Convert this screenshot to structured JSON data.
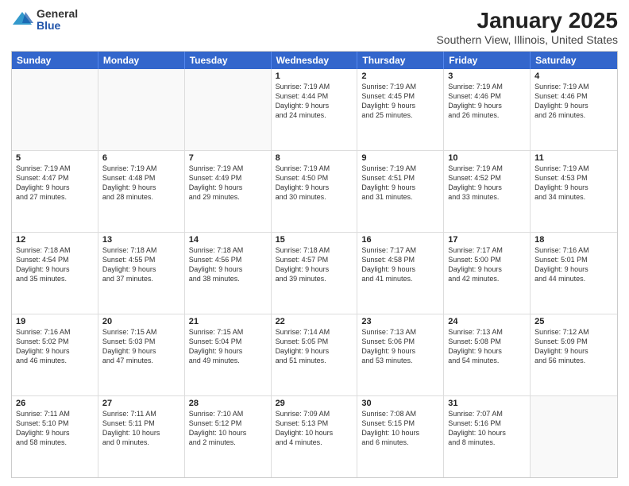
{
  "logo": {
    "general": "General",
    "blue": "Blue"
  },
  "header": {
    "title": "January 2025",
    "subtitle": "Southern View, Illinois, United States"
  },
  "days_of_week": [
    "Sunday",
    "Monday",
    "Tuesday",
    "Wednesday",
    "Thursday",
    "Friday",
    "Saturday"
  ],
  "weeks": [
    [
      {
        "day": "",
        "info": "",
        "empty": true
      },
      {
        "day": "",
        "info": "",
        "empty": true
      },
      {
        "day": "",
        "info": "",
        "empty": true
      },
      {
        "day": "1",
        "info": "Sunrise: 7:19 AM\nSunset: 4:44 PM\nDaylight: 9 hours\nand 24 minutes."
      },
      {
        "day": "2",
        "info": "Sunrise: 7:19 AM\nSunset: 4:45 PM\nDaylight: 9 hours\nand 25 minutes."
      },
      {
        "day": "3",
        "info": "Sunrise: 7:19 AM\nSunset: 4:46 PM\nDaylight: 9 hours\nand 26 minutes."
      },
      {
        "day": "4",
        "info": "Sunrise: 7:19 AM\nSunset: 4:46 PM\nDaylight: 9 hours\nand 26 minutes."
      }
    ],
    [
      {
        "day": "5",
        "info": "Sunrise: 7:19 AM\nSunset: 4:47 PM\nDaylight: 9 hours\nand 27 minutes."
      },
      {
        "day": "6",
        "info": "Sunrise: 7:19 AM\nSunset: 4:48 PM\nDaylight: 9 hours\nand 28 minutes."
      },
      {
        "day": "7",
        "info": "Sunrise: 7:19 AM\nSunset: 4:49 PM\nDaylight: 9 hours\nand 29 minutes."
      },
      {
        "day": "8",
        "info": "Sunrise: 7:19 AM\nSunset: 4:50 PM\nDaylight: 9 hours\nand 30 minutes."
      },
      {
        "day": "9",
        "info": "Sunrise: 7:19 AM\nSunset: 4:51 PM\nDaylight: 9 hours\nand 31 minutes."
      },
      {
        "day": "10",
        "info": "Sunrise: 7:19 AM\nSunset: 4:52 PM\nDaylight: 9 hours\nand 33 minutes."
      },
      {
        "day": "11",
        "info": "Sunrise: 7:19 AM\nSunset: 4:53 PM\nDaylight: 9 hours\nand 34 minutes."
      }
    ],
    [
      {
        "day": "12",
        "info": "Sunrise: 7:18 AM\nSunset: 4:54 PM\nDaylight: 9 hours\nand 35 minutes."
      },
      {
        "day": "13",
        "info": "Sunrise: 7:18 AM\nSunset: 4:55 PM\nDaylight: 9 hours\nand 37 minutes."
      },
      {
        "day": "14",
        "info": "Sunrise: 7:18 AM\nSunset: 4:56 PM\nDaylight: 9 hours\nand 38 minutes."
      },
      {
        "day": "15",
        "info": "Sunrise: 7:18 AM\nSunset: 4:57 PM\nDaylight: 9 hours\nand 39 minutes."
      },
      {
        "day": "16",
        "info": "Sunrise: 7:17 AM\nSunset: 4:58 PM\nDaylight: 9 hours\nand 41 minutes."
      },
      {
        "day": "17",
        "info": "Sunrise: 7:17 AM\nSunset: 5:00 PM\nDaylight: 9 hours\nand 42 minutes."
      },
      {
        "day": "18",
        "info": "Sunrise: 7:16 AM\nSunset: 5:01 PM\nDaylight: 9 hours\nand 44 minutes."
      }
    ],
    [
      {
        "day": "19",
        "info": "Sunrise: 7:16 AM\nSunset: 5:02 PM\nDaylight: 9 hours\nand 46 minutes."
      },
      {
        "day": "20",
        "info": "Sunrise: 7:15 AM\nSunset: 5:03 PM\nDaylight: 9 hours\nand 47 minutes."
      },
      {
        "day": "21",
        "info": "Sunrise: 7:15 AM\nSunset: 5:04 PM\nDaylight: 9 hours\nand 49 minutes."
      },
      {
        "day": "22",
        "info": "Sunrise: 7:14 AM\nSunset: 5:05 PM\nDaylight: 9 hours\nand 51 minutes."
      },
      {
        "day": "23",
        "info": "Sunrise: 7:13 AM\nSunset: 5:06 PM\nDaylight: 9 hours\nand 53 minutes."
      },
      {
        "day": "24",
        "info": "Sunrise: 7:13 AM\nSunset: 5:08 PM\nDaylight: 9 hours\nand 54 minutes."
      },
      {
        "day": "25",
        "info": "Sunrise: 7:12 AM\nSunset: 5:09 PM\nDaylight: 9 hours\nand 56 minutes."
      }
    ],
    [
      {
        "day": "26",
        "info": "Sunrise: 7:11 AM\nSunset: 5:10 PM\nDaylight: 9 hours\nand 58 minutes."
      },
      {
        "day": "27",
        "info": "Sunrise: 7:11 AM\nSunset: 5:11 PM\nDaylight: 10 hours\nand 0 minutes."
      },
      {
        "day": "28",
        "info": "Sunrise: 7:10 AM\nSunset: 5:12 PM\nDaylight: 10 hours\nand 2 minutes."
      },
      {
        "day": "29",
        "info": "Sunrise: 7:09 AM\nSunset: 5:13 PM\nDaylight: 10 hours\nand 4 minutes."
      },
      {
        "day": "30",
        "info": "Sunrise: 7:08 AM\nSunset: 5:15 PM\nDaylight: 10 hours\nand 6 minutes."
      },
      {
        "day": "31",
        "info": "Sunrise: 7:07 AM\nSunset: 5:16 PM\nDaylight: 10 hours\nand 8 minutes."
      },
      {
        "day": "",
        "info": "",
        "empty": true
      }
    ]
  ]
}
